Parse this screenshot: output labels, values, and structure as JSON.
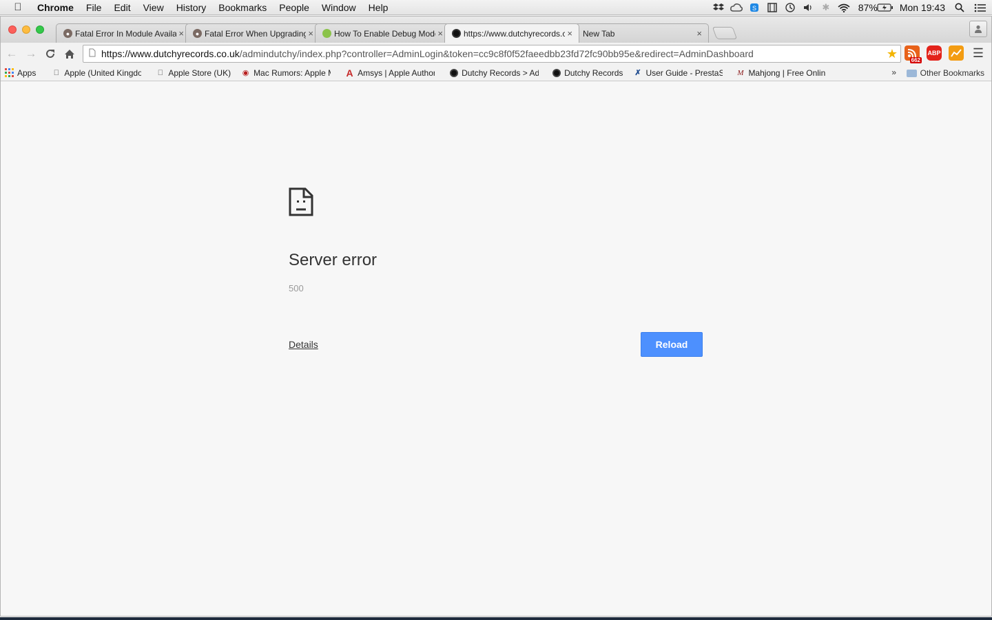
{
  "menubar": {
    "app_name": "Chrome",
    "items": [
      "File",
      "Edit",
      "View",
      "History",
      "Bookmarks",
      "People",
      "Window",
      "Help"
    ],
    "status_icons": [
      "dropbox-icon",
      "creative-cloud-icon",
      "skype-icon",
      "bootcamp-icon",
      "time-machine-icon",
      "volume-icon",
      "bluetooth-icon",
      "wifi-icon"
    ],
    "battery": "87%",
    "clock": "Mon 19:43"
  },
  "tabs": [
    {
      "title": "Fatal Error In Module Available",
      "favicon": "prestashop-icon",
      "active": false
    },
    {
      "title": "Fatal Error When Upgrading",
      "favicon": "prestashop-icon",
      "active": false
    },
    {
      "title": "How To Enable Debug Mode",
      "favicon": "green-leaf-icon",
      "active": false
    },
    {
      "title": "https://www.dutchyrecords.co.uk",
      "favicon": "vinyl-icon",
      "active": true
    },
    {
      "title": "New Tab",
      "favicon": "",
      "active": false
    }
  ],
  "omnibox": {
    "url_host": "https://www.dutchyrecords.co.uk",
    "url_path": "/admindutchy/index.php?controller=AdminLogin&token=cc9c8f0f52faeedbb23fd72fc90bb95e&redirect=AdminDashboard"
  },
  "extensions": [
    {
      "name": "rss-feed-icon",
      "badge": "662",
      "color": "#e8621a"
    },
    {
      "name": "adblock-plus-icon",
      "badge": "ABP",
      "color": "#e3231b"
    },
    {
      "name": "chart-extension-icon",
      "badge": "",
      "color": "#f39c12"
    }
  ],
  "bookmarks": [
    {
      "label": "Apps",
      "icon": "apps-grid-icon"
    },
    {
      "label": "Apple (United Kingdom)",
      "icon": "apple-icon"
    },
    {
      "label": "Apple Store (UK)",
      "icon": "apple-icon"
    },
    {
      "label": "Mac Rumors: Apple Mac",
      "icon": "macrumors-icon"
    },
    {
      "label": "Amsys | Apple Authorised",
      "icon": "amsys-icon"
    },
    {
      "label": "Dutchy Records > Admin",
      "icon": "vinyl-icon"
    },
    {
      "label": "Dutchy Records",
      "icon": "vinyl-icon"
    },
    {
      "label": "User Guide - PrestaShop",
      "icon": "prestashop-icon"
    },
    {
      "label": "Mahjong | Free Online",
      "icon": "mahjong-icon"
    }
  ],
  "bookmarks_overflow": "»",
  "other_bookmarks": "Other Bookmarks",
  "error": {
    "title": "Server error",
    "code": "500",
    "details_label": "Details",
    "reload_label": "Reload"
  },
  "colors": {
    "reload_button": "#4d90fe",
    "page_background": "#f7f7f7"
  }
}
